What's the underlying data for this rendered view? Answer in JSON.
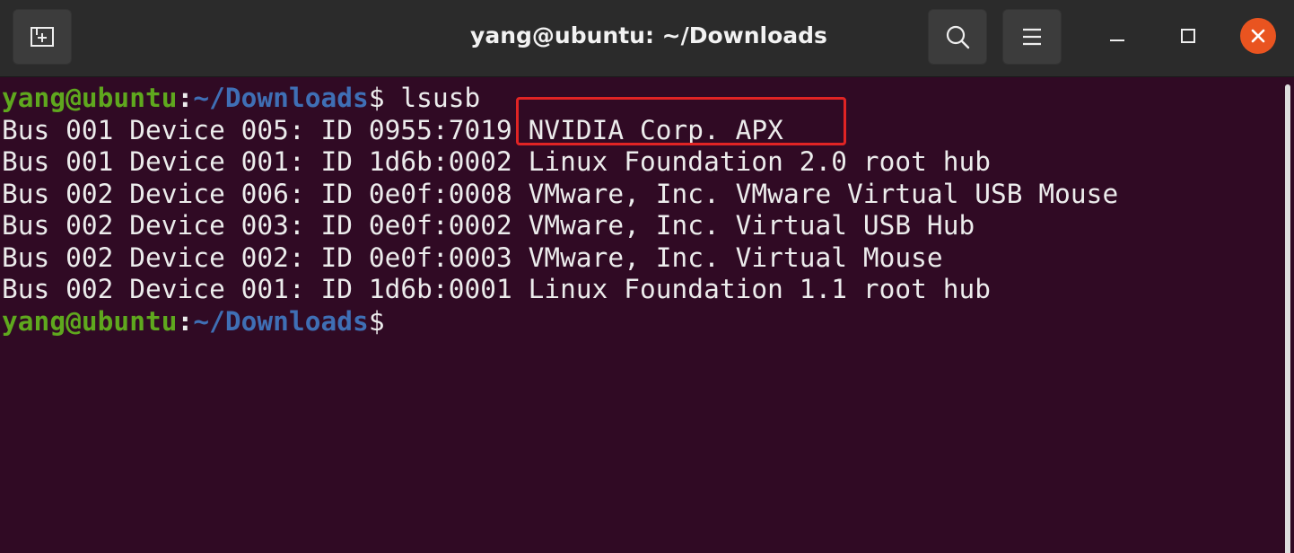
{
  "window": {
    "title": "yang@ubuntu: ~/Downloads"
  },
  "header": {
    "new_tab_icon": "new-tab-icon",
    "search_icon": "search-icon",
    "menu_icon": "hamburger-menu-icon",
    "minimize_icon": "minimize-icon",
    "maximize_icon": "maximize-icon",
    "close_icon": "close-icon"
  },
  "terminal": {
    "prompt": {
      "user_host": "yang@ubuntu",
      "colon": ":",
      "path": "~/Downloads",
      "dollar": "$"
    },
    "command": " lsusb",
    "output": [
      "Bus 001 Device 005: ID 0955:7019 NVIDIA Corp. APX",
      "Bus 001 Device 001: ID 1d6b:0002 Linux Foundation 2.0 root hub",
      "Bus 002 Device 006: ID 0e0f:0008 VMware, Inc. VMware Virtual USB Mouse",
      "Bus 002 Device 003: ID 0e0f:0002 VMware, Inc. Virtual USB Hub",
      "Bus 002 Device 002: ID 0e0f:0003 VMware, Inc. Virtual Mouse",
      "Bus 002 Device 001: ID 1d6b:0001 Linux Foundation 1.1 root hub"
    ]
  },
  "colors": {
    "terminal_bg": "#300a24",
    "headerbar_bg": "#2b2b2b",
    "prompt_user": "#5fa81e",
    "prompt_path": "#3f6fb5",
    "close_button": "#e95420",
    "highlight_box": "#e02424"
  }
}
